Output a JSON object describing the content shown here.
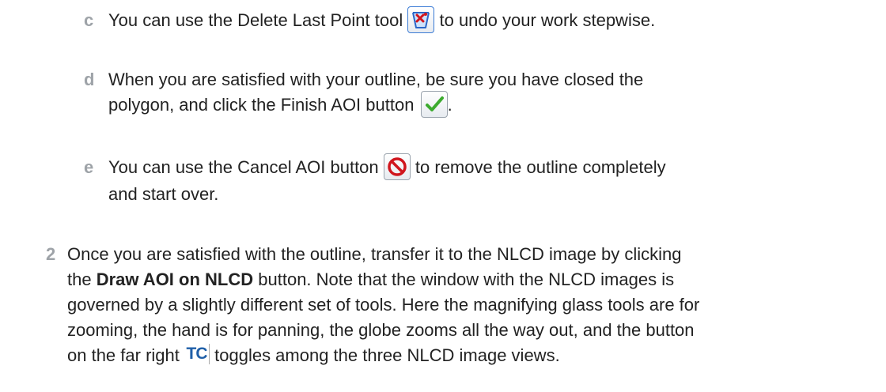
{
  "steps": {
    "c": {
      "marker": "c",
      "before": "You can use the Delete Last Point tool",
      "after": "to undo your work stepwise.",
      "icon": "delete-last-point-icon"
    },
    "d": {
      "marker": "d",
      "line1": "When you are satisfied with your outline, be sure you have closed the",
      "line2_before": "polygon, and click the Finish AOI button",
      "line2_after": ".",
      "icon": "check-icon"
    },
    "e": {
      "marker": "e",
      "line1_before": "You can use the Cancel AOI button",
      "line1_after": "to remove the outline completely",
      "line2": "and start over.",
      "icon": "cancel-icon"
    },
    "two": {
      "marker": "2",
      "line1": "Once you are satisfied with the outline, transfer it to the NLCD image by clicking",
      "line2_pre": "the",
      "line2_bold": "Draw AOI on NLCD",
      "line2_post": "button. Note that the window with the NLCD images is",
      "line3": "governed by a slightly different set of tools. Here the magnifying glass tools are for",
      "line4": "zooming, the hand is for panning, the globe zooms all the way out, and the button",
      "line5_before": "on the far right",
      "tc_label": "TC",
      "line5_after": "toggles among the three NLCD image views."
    }
  },
  "colors": {
    "marker": "#9ea3a8",
    "text": "#222222",
    "check": "#3cab2f",
    "cancel": "#d0161e",
    "delete_x": "#d0161e",
    "tc": "#1f5fa8"
  }
}
